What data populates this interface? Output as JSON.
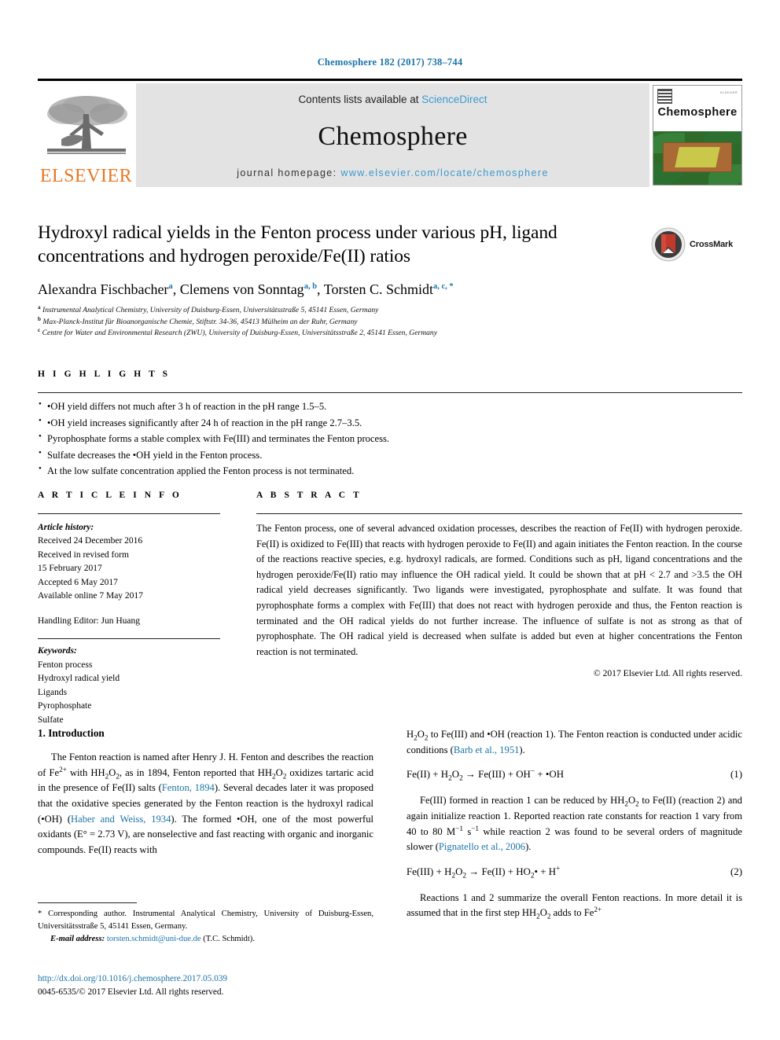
{
  "running_head": "Chemosphere 182 (2017) 738–744",
  "masthead": {
    "publisher_name": "ELSEVIER",
    "contents_prefix": "Contents lists available at ",
    "contents_link": "ScienceDirect",
    "journal_title": "Chemosphere",
    "homepage_prefix": "journal homepage: ",
    "homepage_url": "www.elsevier.com/locate/chemosphere",
    "cover_journal_name": "Chemosphere",
    "cover_mini_text": "ELSEVIER"
  },
  "crossmark": {
    "label": "CrossMark"
  },
  "article": {
    "title": "Hydroxyl radical yields in the Fenton process under various pH, ligand concentrations and hydrogen peroxide/Fe(II) ratios",
    "authors": [
      {
        "name": "Alexandra Fischbacher",
        "marks": "a"
      },
      {
        "name": "Clemens von Sonntag",
        "marks": "a, b"
      },
      {
        "name": "Torsten C. Schmidt",
        "marks": "a, c, *"
      }
    ],
    "affiliations": [
      {
        "mark": "a",
        "text": "Instrumental Analytical Chemistry, University of Duisburg-Essen, Universitätsstraße 5, 45141 Essen, Germany"
      },
      {
        "mark": "b",
        "text": "Max-Planck-Institut für Bioanorganische Chemie, Stiftstr. 34-36, 45413 Mülheim an der Ruhr, Germany"
      },
      {
        "mark": "c",
        "text": "Centre for Water and Environmental Research (ZWU), University of Duisburg-Essen, Universitätsstraße 2, 45141 Essen, Germany"
      }
    ]
  },
  "highlights": {
    "heading": "H I G H L I G H T S",
    "items": [
      "•OH yield differs not much after 3 h of reaction in the pH range 1.5–5.",
      "•OH yield increases significantly after 24 h of reaction in the pH range 2.7–3.5.",
      "Pyrophosphate forms a stable complex with Fe(III) and terminates the Fenton process.",
      "Sulfate decreases the •OH yield in the Fenton process.",
      "At the low sulfate concentration applied the Fenton process is not terminated."
    ]
  },
  "article_info": {
    "heading": "A R T I C L E   I N F O",
    "history_label": "Article history:",
    "history": [
      "Received 24 December 2016",
      "Received in revised form",
      "15 February 2017",
      "Accepted 6 May 2017",
      "Available online 7 May 2017"
    ],
    "handling_editor": "Handling Editor: Jun Huang",
    "keywords_label": "Keywords:",
    "keywords": [
      "Fenton process",
      "Hydroxyl radical yield",
      "Ligands",
      "Pyrophosphate",
      "Sulfate"
    ]
  },
  "abstract": {
    "heading": "A B S T R A C T",
    "text": "The Fenton process, one of several advanced oxidation processes, describes the reaction of Fe(II) with hydrogen peroxide. Fe(II) is oxidized to Fe(III) that reacts with hydrogen peroxide to Fe(II) and again initiates the Fenton reaction. In the course of the reactions reactive species, e.g. hydroxyl radicals, are formed. Conditions such as pH, ligand concentrations and the hydrogen peroxide/Fe(II) ratio may influence the OH radical yield. It could be shown that at pH < 2.7 and >3.5 the OH radical yield decreases significantly. Two ligands were investigated, pyrophosphate and sulfate. It was found that pyrophosphate forms a complex with Fe(III) that does not react with hydrogen peroxide and thus, the Fenton reaction is terminated and the OH radical yields do not further increase. The influence of sulfate is not as strong as that of pyrophosphate. The OH radical yield is decreased when sulfate is added but even at higher concentrations the Fenton reaction is not terminated.",
    "copyright": "© 2017 Elsevier Ltd. All rights reserved."
  },
  "body": {
    "section_heading": "1. Introduction",
    "para_left_1_a": "The Fenton reaction is named after Henry J. H. Fenton and describes the reaction of Fe",
    "para_left_1_b": " with H",
    "para_left_1_c": ", as in 1894, Fenton reported that H",
    "para_left_1_d": " oxidizes tartaric acid in the presence of Fe(II) salts (",
    "ref_fenton": "Fenton, 1894",
    "para_left_1_e": "). Several decades later it was proposed that the oxidative species generated by the Fenton reaction is the hydroxyl radical (•OH) (",
    "ref_haber": "Haber and Weiss, 1934",
    "para_left_1_f": "). The formed •OH, one of the most powerful oxidants (E° = 2.73 V), are nonselective and fast reacting with organic and inorganic compounds. Fe(II) reacts with",
    "para_right_1_a": " to Fe(III) and •OH (reaction 1). The Fenton reaction is conducted under acidic conditions (",
    "ref_barb": "Barb et al., 1951",
    "para_right_1_b": ").",
    "eq1_number": "(1)",
    "eq2_number": "(2)",
    "para_right_2_a": "Fe(III) formed in reaction 1 can be reduced by H",
    "para_right_2_b": " to Fe(II) (reaction 2) and again initialize reaction 1. Reported reaction rate constants for reaction 1 vary from 40 to 80 M",
    "para_right_2_c": " while reaction 2 was found to be several orders of magnitude slower (",
    "ref_pignatello": "Pignatello et al., 2006",
    "para_right_2_d": ").",
    "para_right_3_a": "Reactions 1 and 2 summarize the overall Fenton reactions. In more detail it is assumed that in the first step H",
    "para_right_3_b": " adds to Fe",
    "para_right_3_c": "2+"
  },
  "footnote": {
    "star": "*",
    "corresponding": " Corresponding author. Instrumental Analytical Chemistry, University of Duisburg-Essen, Universitätsstraße 5, 45141 Essen, Germany.",
    "email_label": "E-mail address:",
    "email": "torsten.schmidt@uni-due.de",
    "email_suffix": " (T.C. Schmidt)."
  },
  "doi": {
    "url": "http://dx.doi.org/10.1016/j.chemosphere.2017.05.039",
    "issn_line": "0045-6535/© 2017 Elsevier Ltd. All rights reserved."
  },
  "colors": {
    "link": "#1a74a8",
    "sciencedirect": "#3b9ad0",
    "elsevier_orange": "#E87722",
    "band_gray": "#e3e3e3"
  }
}
